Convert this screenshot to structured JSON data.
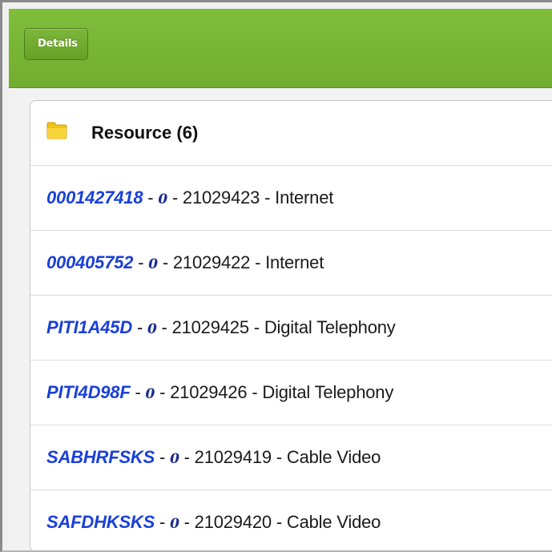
{
  "header": {
    "back_label": "Details"
  },
  "panel": {
    "title": "Resource (6)",
    "icon": "folder-icon"
  },
  "colors": {
    "header_green": "#78b434",
    "link_blue": "#1a40d8",
    "zero_navy": "#1a2b8f"
  },
  "resources": [
    {
      "id": "0001427418",
      "zero": "0",
      "number": "21029423",
      "type": "Internet"
    },
    {
      "id": "000405752",
      "zero": "0",
      "number": "21029422",
      "type": "Internet"
    },
    {
      "id": "PITI1A45D",
      "zero": "0",
      "number": "21029425",
      "type": "Digital Telephony"
    },
    {
      "id": "PITI4D98F",
      "zero": "0",
      "number": "21029426",
      "type": "Digital Telephony"
    },
    {
      "id": "SABHRFSKS",
      "zero": "0",
      "number": "21029419",
      "type": "Cable Video"
    },
    {
      "id": "SAFDHKSKS",
      "zero": "0",
      "number": "21029420",
      "type": "Cable Video"
    }
  ]
}
